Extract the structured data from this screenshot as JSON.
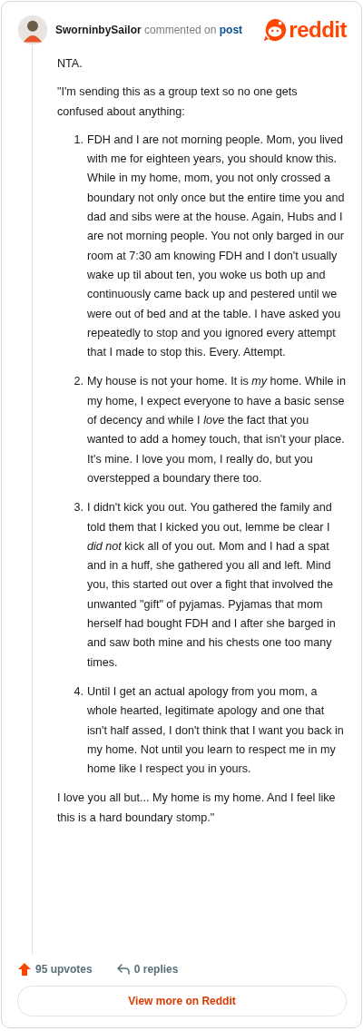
{
  "header": {
    "author": "SworninbySailor",
    "action": "commented on",
    "link": "post",
    "logo_text": "reddit"
  },
  "comment": {
    "intro": [
      "NTA.",
      "\"I'm sending this as a group text so no one gets confused about anything:"
    ],
    "list": [
      {
        "number": "1.",
        "text": "FDH and I are not morning people. Mom, you lived with me for eighteen years, you should know this. While in my home, mom, you not only crossed a boundary not only once but the entire time you and dad and sibs were at the house. Again, Hubs and I are not morning people. You not only barged in our room at 7:30 am knowing FDH and I don't usually wake up til about ten, you woke us both up and continuously came back up and pestered until we were out of bed and at the table. I have asked you repeatedly to stop and you ignored every attempt that I made to stop this. Every. Attempt."
      },
      {
        "number": "2.",
        "text": "My house is not your home. It is *my* home. While in my home, I expect everyone to have a basic sense of decency and while I *love* the fact that you wanted to add a homey touch, that isn't your place. It's mine. I love you mom, I really do, but you overstepped a boundary there too."
      },
      {
        "number": "3.",
        "text": "I didn't kick you out. You gathered the family and told them that I kicked you out, lemme be clear I *did not* kick all of you out. Mom and I had a spat and in a huff, she gathered you all and left. Mind you, this started out over a fight that involved the unwanted \"gift\" of pyjamas. Pyjamas that mom herself had bought FDH and I after she barged in and saw both mine and his chests one too many times."
      },
      {
        "number": "4.",
        "text": "Until I get an actual apology from you mom, a whole hearted, legitimate apology and one that isn't half assed, I don't think that I want you back in my home. Not until you learn to respect me in my home like I respect you in yours."
      }
    ],
    "outro": "I love you all but... My home is my home. And I feel like this is a hard boundary stomp.\""
  },
  "footer": {
    "upvotes": "95 upvotes",
    "replies": "0 replies",
    "button": "View more on Reddit"
  }
}
